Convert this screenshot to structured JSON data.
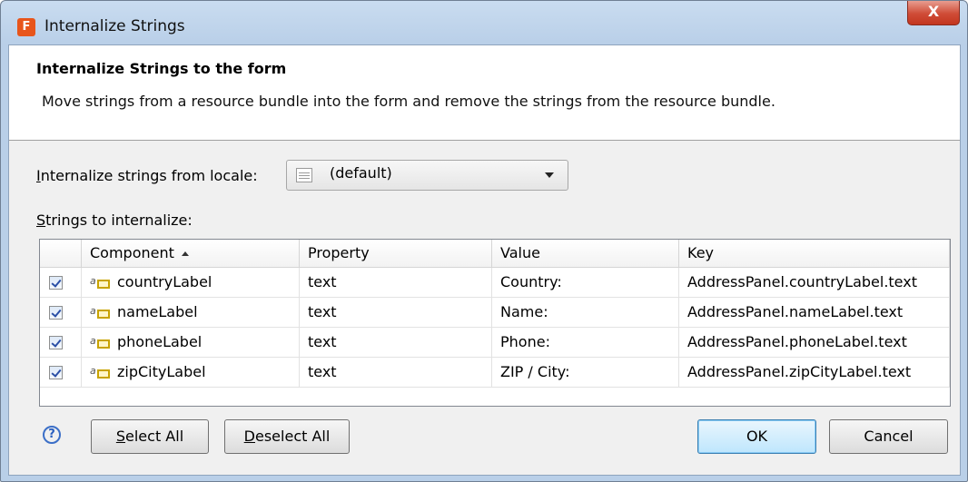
{
  "window": {
    "title": "Internalize Strings",
    "app_icon_glyph": "F",
    "close_glyph": "X"
  },
  "header": {
    "title": "Internalize Strings to the form",
    "description": "Move strings from a resource bundle into the form and remove the strings from the resource bundle."
  },
  "locale": {
    "label_mnemonic": "I",
    "label_rest": "nternalize strings from locale:",
    "selected": "(default)"
  },
  "strings": {
    "label_mnemonic": "S",
    "label_rest": "trings to internalize:"
  },
  "table": {
    "columns": [
      "Component",
      "Property",
      "Value",
      "Key"
    ],
    "rows": [
      {
        "checked": true,
        "component": "countryLabel",
        "property": "text",
        "value": "Country:",
        "key": "AddressPanel.countryLabel.text"
      },
      {
        "checked": true,
        "component": "nameLabel",
        "property": "text",
        "value": "Name:",
        "key": "AddressPanel.nameLabel.text"
      },
      {
        "checked": true,
        "component": "phoneLabel",
        "property": "text",
        "value": "Phone:",
        "key": "AddressPanel.phoneLabel.text"
      },
      {
        "checked": true,
        "component": "zipCityLabel",
        "property": "text",
        "value": "ZIP / City:",
        "key": "AddressPanel.zipCityLabel.text"
      }
    ]
  },
  "buttons": {
    "help_glyph": "?",
    "select_all_mnemonic": "S",
    "select_all_rest": "elect All",
    "deselect_all_mnemonic": "D",
    "deselect_all_rest": "eselect All",
    "ok": "OK",
    "cancel": "Cancel"
  },
  "icons": {
    "component_icon": "label-component-icon",
    "row_checkbox": "checked-checkbox-icon"
  }
}
